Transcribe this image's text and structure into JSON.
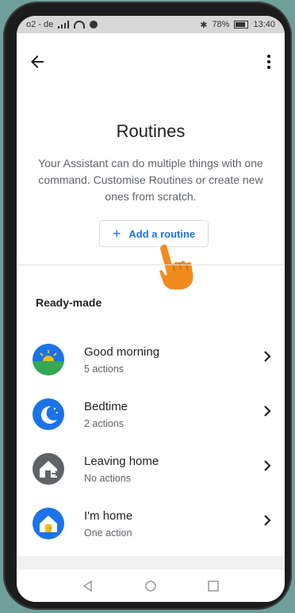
{
  "status_bar": {
    "carrier": "o2 - de",
    "battery": "78%",
    "time": "13:40"
  },
  "header": {
    "title": "Routines",
    "description": "Your Assistant can do multiple things with one command. Customise Routines or create new ones from scratch.",
    "add_label": "Add a routine"
  },
  "section": {
    "title": "Ready-made"
  },
  "routines": [
    {
      "name": "Good morning",
      "sub": "5 actions",
      "icon": "sunrise-icon"
    },
    {
      "name": "Bedtime",
      "sub": "2 actions",
      "icon": "moon-icon"
    },
    {
      "name": "Leaving home",
      "sub": "No actions",
      "icon": "house-leave-icon"
    },
    {
      "name": "I'm home",
      "sub": "One action",
      "icon": "house-icon"
    }
  ],
  "colors": {
    "accent": "#1a73e8",
    "frame": "#1c1c1c",
    "background": "#6f9f9a"
  }
}
